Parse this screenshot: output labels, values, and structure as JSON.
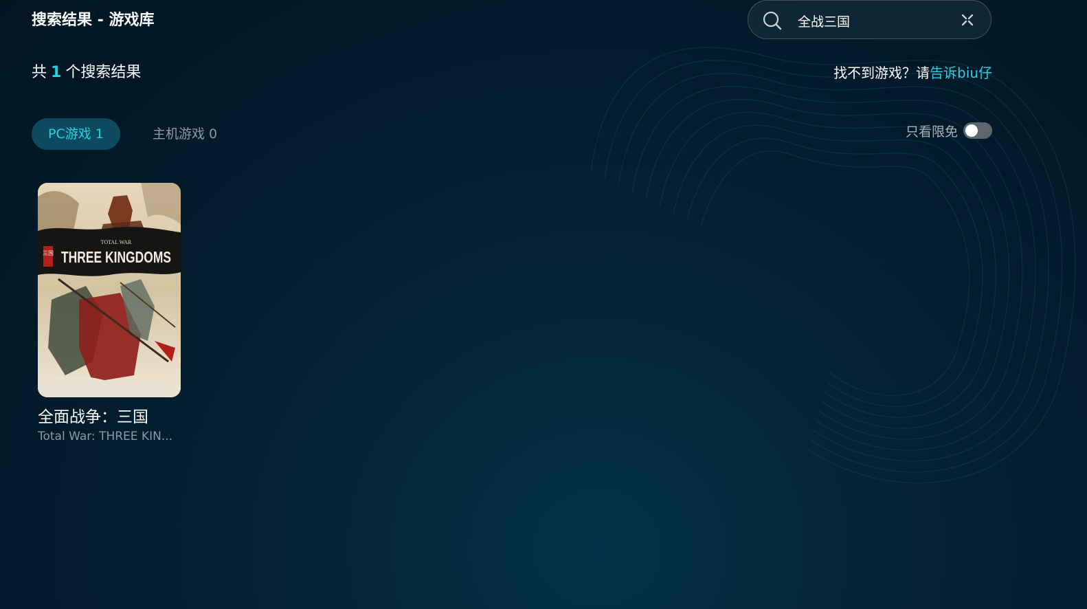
{
  "page": {
    "title": "搜索结果 - 游戏库"
  },
  "search": {
    "value": "全战三国",
    "placeholder": ""
  },
  "results": {
    "prefix": "共",
    "count": "1",
    "suffix": "个搜索结果"
  },
  "feedback": {
    "text": "找不到游戏？请",
    "link_label": "告诉biu仔"
  },
  "tabs": [
    {
      "label": "PC游戏 1",
      "active": true
    },
    {
      "label": "主机游戏 0",
      "active": false
    }
  ],
  "filter": {
    "label": "只看限免",
    "enabled": false
  },
  "games": [
    {
      "title": "全面战争：三国",
      "subtitle": "Total War: THREE KIN...",
      "cover_logo_top": "TOTAL WAR",
      "cover_logo_main": "THREE KINGDOMS",
      "cover_seal": "三国"
    }
  ],
  "colors": {
    "accent": "#22d3e6",
    "tab_active_bg": "#0d4a5e",
    "background": "#021a29"
  }
}
